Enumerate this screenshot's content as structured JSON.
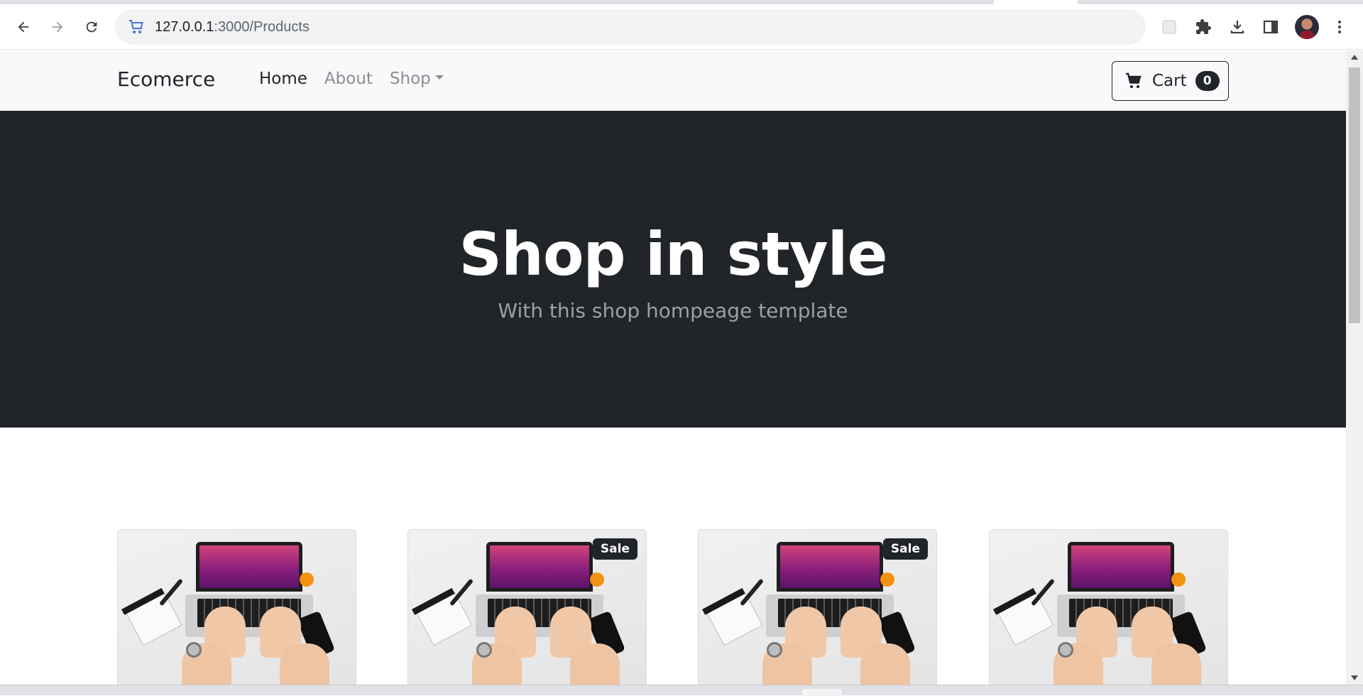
{
  "browser": {
    "url_host": "127.0.0.1",
    "url_rest": ":3000/Products"
  },
  "site": {
    "brand": "Ecomerce",
    "nav": {
      "home": "Home",
      "about": "About",
      "shop": "Shop"
    },
    "cart": {
      "label": "Cart",
      "count": "0"
    }
  },
  "hero": {
    "title": "Shop in style",
    "subtitle": "With this shop hompeage template"
  },
  "products": [
    {
      "sale": false,
      "badge": ""
    },
    {
      "sale": true,
      "badge": "Sale"
    },
    {
      "sale": true,
      "badge": "Sale"
    },
    {
      "sale": false,
      "badge": ""
    }
  ],
  "colors": {
    "dark": "#212529",
    "nav_bg": "#f8f9fa",
    "muted_text": "#8a8e92"
  }
}
